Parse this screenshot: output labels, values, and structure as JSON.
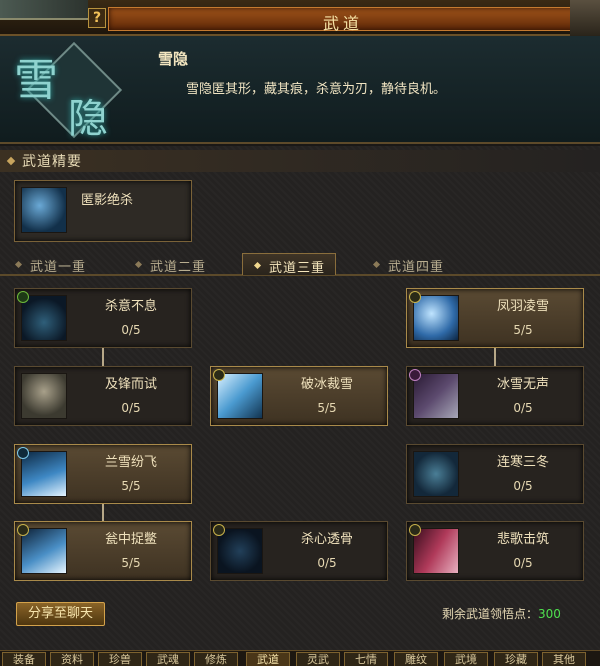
{
  "window": {
    "title": "武道"
  },
  "header": {
    "emblem_chars": [
      "雪",
      "隐"
    ],
    "skill_name": "雪隐",
    "skill_desc": "雪隐匿其形，藏其痕，杀意为刃，静待良机。"
  },
  "section": {
    "title": "武道精要"
  },
  "core": {
    "name": "匿影绝杀"
  },
  "tabs": [
    {
      "label": "武道一重",
      "active": false
    },
    {
      "label": "武道二重",
      "active": false
    },
    {
      "label": "武道三重",
      "active": true
    },
    {
      "label": "武道四重",
      "active": false
    }
  ],
  "nodes": [
    {
      "name": "杀意不息",
      "points": "0/5",
      "lit": false,
      "icon": "assassin-icon"
    },
    {
      "name": "凤羽凌雪",
      "points": "5/5",
      "lit": true,
      "icon": "phoenix-feather-icon"
    },
    {
      "name": "及锋而试",
      "points": "0/5",
      "lit": false,
      "icon": "bald-warrior-icon"
    },
    {
      "name": "破冰裁雪",
      "points": "5/5",
      "lit": true,
      "icon": "ice-break-icon"
    },
    {
      "name": "冰雪无声",
      "points": "0/5",
      "lit": false,
      "icon": "silent-frost-icon"
    },
    {
      "name": "兰雪纷飞",
      "points": "5/5",
      "lit": true,
      "icon": "orchid-snow-icon"
    },
    {
      "name": "连寒三冬",
      "points": "0/5",
      "lit": false,
      "icon": "triple-winter-icon"
    },
    {
      "name": "瓮中捉鳖",
      "points": "5/5",
      "lit": true,
      "icon": "trap-icon"
    },
    {
      "name": "杀心透骨",
      "points": "0/5",
      "lit": false,
      "icon": "bone-pierce-icon"
    },
    {
      "name": "悲歌击筑",
      "points": "0/5",
      "lit": false,
      "icon": "sorrow-song-icon"
    }
  ],
  "footer": {
    "share_label": "分享至聊天",
    "points_label": "剩余武道领悟点：",
    "points_value": "300"
  },
  "bottom_tabs": [
    "装备",
    "资料",
    "珍兽",
    "武魂",
    "修炼",
    "武道",
    "灵武",
    "七情",
    "雕纹",
    "武境",
    "珍藏",
    "其他"
  ],
  "colors": {
    "title_band": "#a0541a",
    "points_value": "#4fe04f",
    "lit_node": "#5a4a33"
  }
}
